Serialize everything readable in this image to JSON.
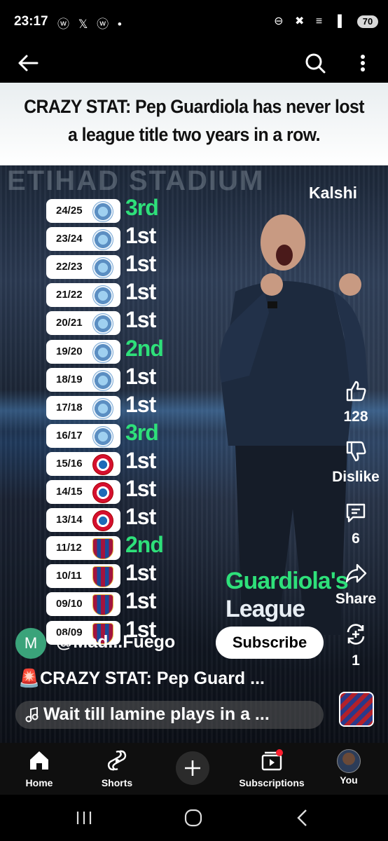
{
  "status_bar": {
    "time": "23:17",
    "left_icons": "ⓦ 𝕏 ⓦ •",
    "right_icons": "⊖ ✖ ≡ ▐",
    "battery": "70"
  },
  "header": {
    "title": "CRAZY STAT: Pep Guardiola has never lost a league title two years in a row."
  },
  "video": {
    "brand": "Kalshi",
    "stadium_text": "ETIHAD STADIUM",
    "seasons": [
      {
        "season": "24/25",
        "club": "city",
        "place": "3rd",
        "color": "green"
      },
      {
        "season": "23/24",
        "club": "city",
        "place": "1st",
        "color": "white"
      },
      {
        "season": "22/23",
        "club": "city",
        "place": "1st",
        "color": "white"
      },
      {
        "season": "21/22",
        "club": "city",
        "place": "1st",
        "color": "white"
      },
      {
        "season": "20/21",
        "club": "city",
        "place": "1st",
        "color": "white"
      },
      {
        "season": "19/20",
        "club": "city",
        "place": "2nd",
        "color": "green"
      },
      {
        "season": "18/19",
        "club": "city",
        "place": "1st",
        "color": "white"
      },
      {
        "season": "17/18",
        "club": "city",
        "place": "1st",
        "color": "white"
      },
      {
        "season": "16/17",
        "club": "city",
        "place": "3rd",
        "color": "green"
      },
      {
        "season": "15/16",
        "club": "bayern",
        "place": "1st",
        "color": "white"
      },
      {
        "season": "14/15",
        "club": "bayern",
        "place": "1st",
        "color": "white"
      },
      {
        "season": "13/14",
        "club": "bayern",
        "place": "1st",
        "color": "white"
      },
      {
        "season": "11/12",
        "club": "barca",
        "place": "2nd",
        "color": "green"
      },
      {
        "season": "10/11",
        "club": "barca",
        "place": "1st",
        "color": "white"
      },
      {
        "season": "09/10",
        "club": "barca",
        "place": "1st",
        "color": "white"
      },
      {
        "season": "08/09",
        "club": "barca",
        "place": "1st",
        "color": "white"
      }
    ],
    "overlay_line1": "Guardiola's",
    "overlay_line2": "League"
  },
  "actions": {
    "likes": "128",
    "dislike": "Dislike",
    "comments": "6",
    "share": "Share",
    "remix": "1"
  },
  "channel": {
    "avatar_letter": "M",
    "name": "@Mad...Fuego",
    "subscribe": "Subscribe"
  },
  "video_title": "🚨CRAZY STAT: Pep Guard ...",
  "sound": "Wait till lamine plays in a ...",
  "nav": {
    "home": "Home",
    "shorts": "Shorts",
    "subscriptions": "Subscriptions",
    "you": "You"
  }
}
